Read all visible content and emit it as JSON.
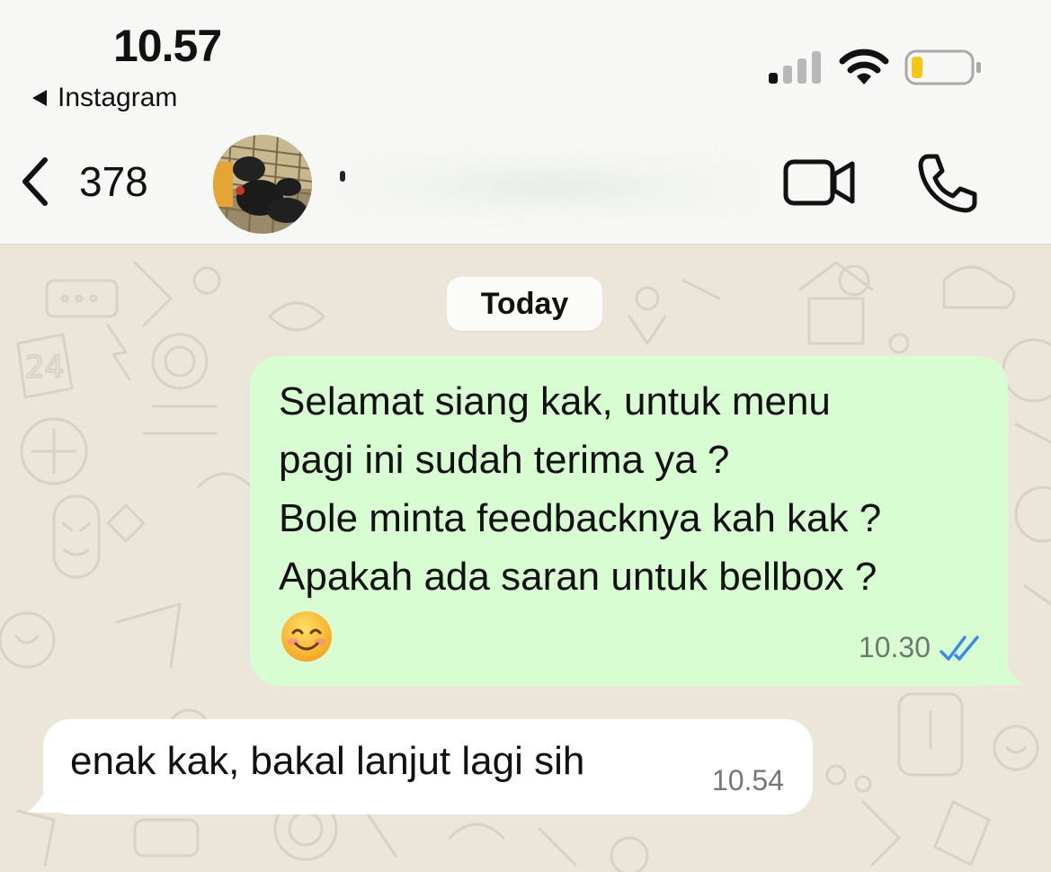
{
  "status_bar": {
    "time": "10.57",
    "back_app_label": "Instagram"
  },
  "header": {
    "unread_count": "378",
    "contact_name": ""
  },
  "chat": {
    "date_chip": "Today",
    "messages": [
      {
        "direction": "outgoing",
        "text": "Selamat siang kak, untuk menu\npagi ini sudah terima ya ?\nBole minta feedbacknya kah kak ?\nApakah ada saran untuk bellbox ?",
        "emoji": "😊",
        "time": "10.30",
        "status": "read"
      },
      {
        "direction": "incoming",
        "text": "enak kak, bakal lanjut lagi sih",
        "time": "10.54"
      }
    ]
  },
  "icons": {
    "back": "chevron-left-icon",
    "video_call": "video-camera-icon",
    "voice_call": "phone-icon",
    "signal": "cellular-signal-icon",
    "wifi": "wifi-icon",
    "battery": "battery-low-icon",
    "read_receipt": "double-check-icon"
  },
  "colors": {
    "outgoing_bubble": "#d8fdd2",
    "incoming_bubble": "#ffffff",
    "chat_background": "#ece5d9",
    "read_tick": "#3b8ce0",
    "battery_level": "#f5c518"
  }
}
